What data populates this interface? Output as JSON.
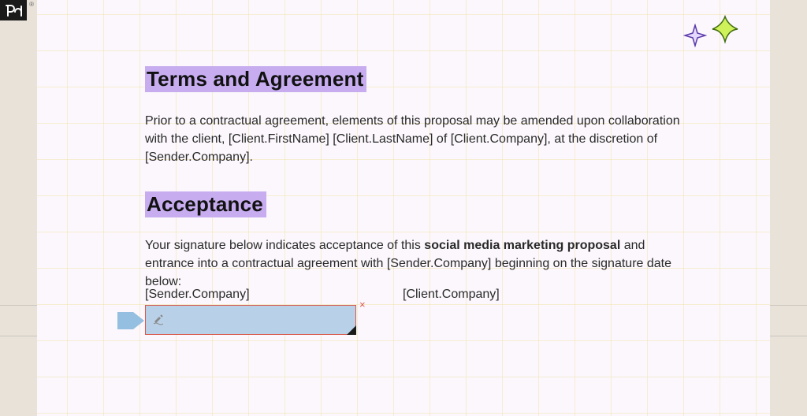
{
  "logo": {
    "text": "pd",
    "reg": "®"
  },
  "doc": {
    "headings": {
      "terms": "Terms and Agreement",
      "acceptance": "Acceptance"
    },
    "paragraphs": {
      "terms_before": "Prior to a contractual agreement, elements of this proposal may be amended upon collaboration with the client, ",
      "terms_tokens": "[Client.FirstName] [Client.LastName]",
      "terms_of": " of ",
      "terms_company": "[Client.Company]",
      "terms_after": ", at the discretion of ",
      "terms_sender": "[Sender.Company]",
      "terms_end": ".",
      "accept_before": "Your signature below indicates acceptance of this ",
      "accept_bold": "social media marketing proposal",
      "accept_after": " and entrance into a contractual agreement with ",
      "accept_sender": "[Sender.Company]",
      "accept_tail": " beginning on the signature date below:"
    },
    "signature": {
      "sender_label": "[Sender.Company]",
      "client_label": "[Client.Company]",
      "remove_glyph": "×"
    }
  }
}
